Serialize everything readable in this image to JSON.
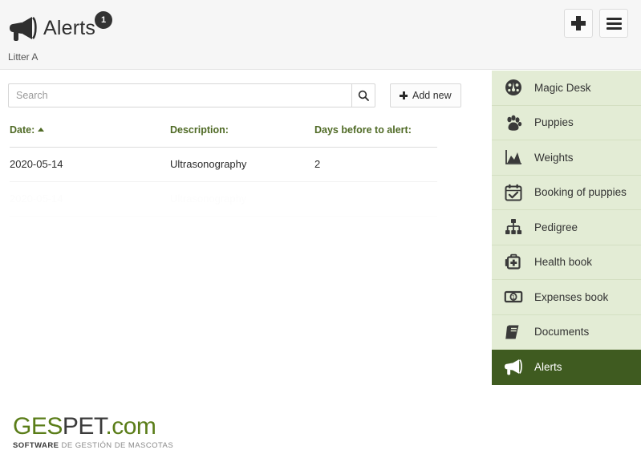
{
  "header": {
    "icon": "megaphone-icon",
    "title": "Alerts",
    "badge": "1",
    "subtitle": "Litter A",
    "add_button_icon": "plus-icon",
    "menu_button_icon": "hamburger-menu-icon"
  },
  "toolbar": {
    "search_placeholder": "Search",
    "search_value": "",
    "search_icon": "search-icon",
    "add_new_label": "Add new",
    "add_new_icon": "plus-icon"
  },
  "table": {
    "columns": [
      {
        "label": "Date:",
        "sorted": "asc"
      },
      {
        "label": "Description:",
        "sorted": ""
      },
      {
        "label": "Days before to alert:",
        "sorted": ""
      }
    ],
    "rows": [
      {
        "date": "2020-05-14",
        "description": "Ultrasonography",
        "days": "2"
      }
    ],
    "ghost_row": {
      "date": "2020-05-14",
      "description": "Ultrasonography",
      "days": ""
    }
  },
  "logo": {
    "part1": "GES",
    "part2": "PET",
    "part3": ".com",
    "sub1": "SOFTWARE ",
    "sub2": "DE GESTIÓN DE MASCOTAS"
  },
  "sidebar": {
    "items": [
      {
        "label": "Magic Desk",
        "icon": "dashboard-gauge-icon",
        "active": false
      },
      {
        "label": "Puppies",
        "icon": "paw-print-icon",
        "active": false
      },
      {
        "label": "Weights",
        "icon": "area-chart-icon",
        "active": false
      },
      {
        "label": "Booking of puppies",
        "icon": "calendar-check-icon",
        "active": false
      },
      {
        "label": "Pedigree",
        "icon": "sitemap-tree-icon",
        "active": false
      },
      {
        "label": "Health book",
        "icon": "first-aid-kit-icon",
        "active": false
      },
      {
        "label": "Expenses book",
        "icon": "banknote-icon",
        "active": false
      },
      {
        "label": "Documents",
        "icon": "book-icon",
        "active": false
      },
      {
        "label": "Alerts",
        "icon": "megaphone-icon",
        "active": true
      }
    ]
  },
  "colors": {
    "header_bg": "#f6f6f6",
    "sidebar_bg": "#e3ecd5",
    "sidebar_active_bg": "#3f5b20",
    "table_header_text": "#4f6a25",
    "logo_green": "#5a7d18",
    "badge_bg": "#333333"
  }
}
